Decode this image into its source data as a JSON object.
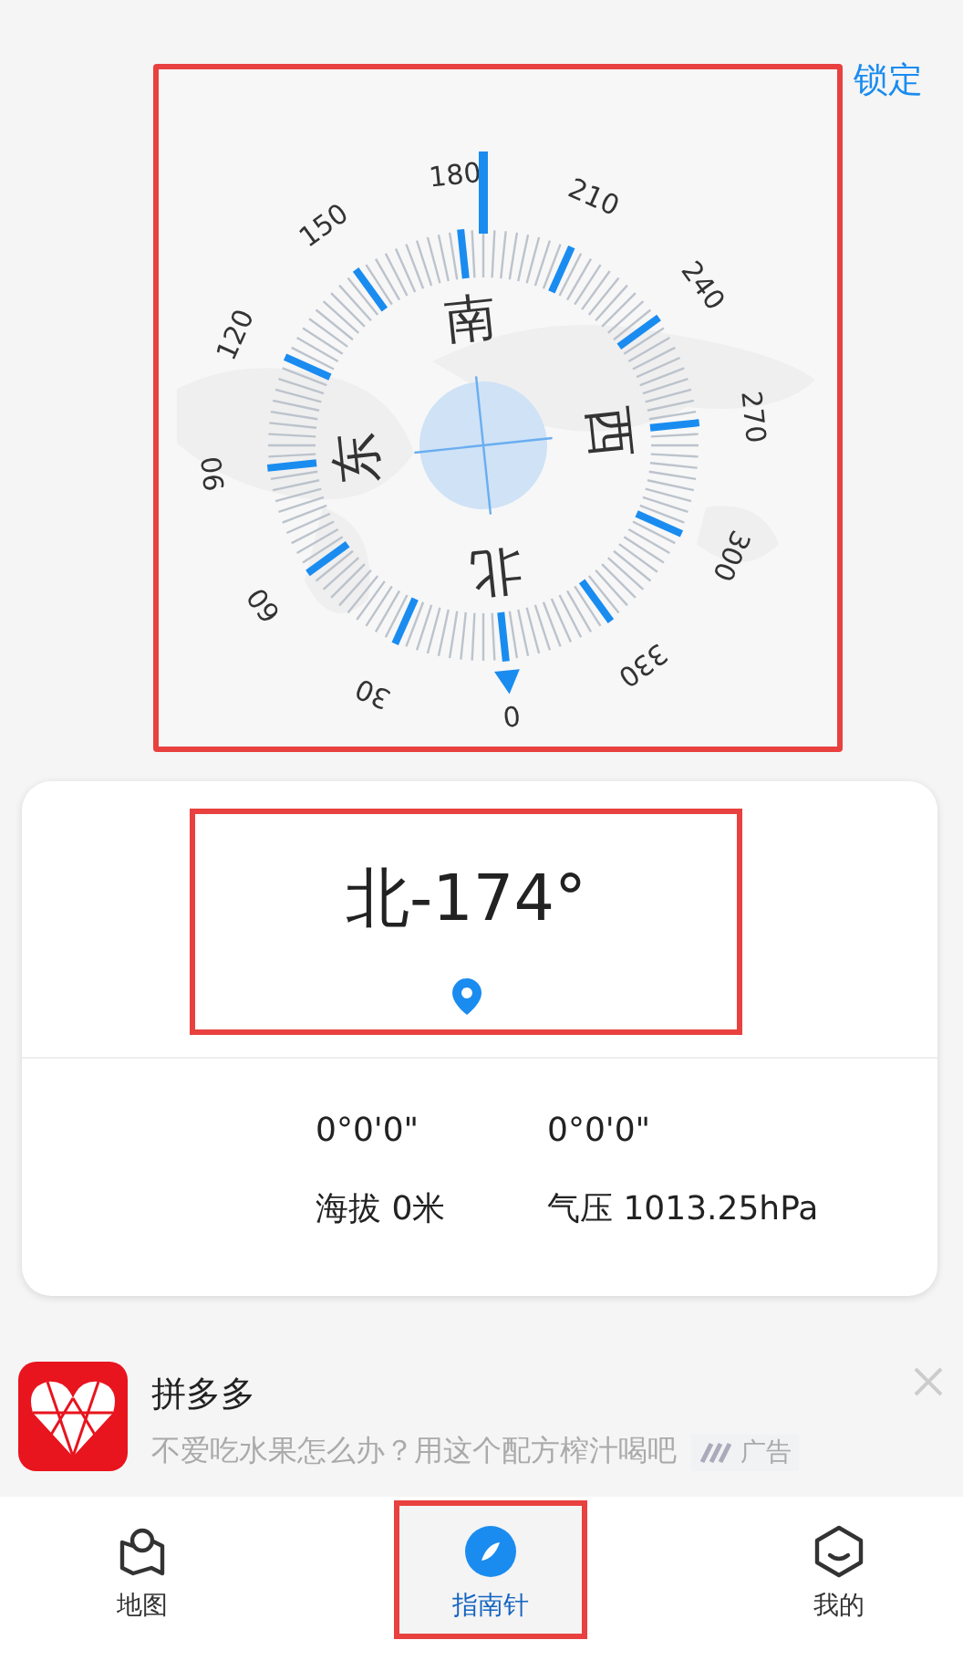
{
  "lock_button": "锁定",
  "compass": {
    "highlighted": true,
    "scale_labels": [
      "0",
      "30",
      "60",
      "90",
      "120",
      "150",
      "180",
      "210",
      "240",
      "270",
      "300",
      "330"
    ],
    "cardinals": [
      "北",
      "东",
      "南",
      "西"
    ]
  },
  "reading": {
    "highlighted": true,
    "heading": "北-174°"
  },
  "details": [
    {
      "label": "0°0'0\""
    },
    {
      "label": "0°0'0\""
    },
    {
      "label": "海拔 0米"
    },
    {
      "label": "气压 1013.25hPa"
    }
  ],
  "ad": {
    "title": "拼多多",
    "text": "不爱吃水果怎么办？用这个配方榨汁喝吧",
    "badge": "广告"
  },
  "nav": [
    {
      "label": "地图",
      "kind": "map",
      "selected": false,
      "highlighted": false
    },
    {
      "label": "指南针",
      "kind": "compass",
      "selected": true,
      "highlighted": true
    },
    {
      "label": "我的",
      "kind": "me",
      "selected": false,
      "highlighted": false
    }
  ]
}
